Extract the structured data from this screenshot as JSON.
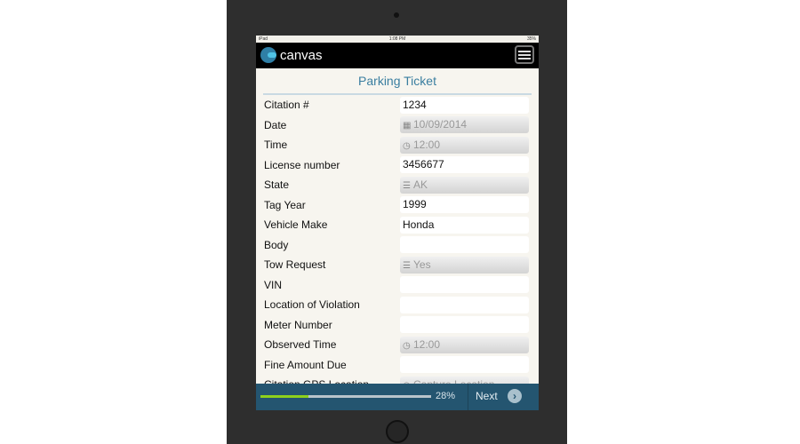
{
  "status": {
    "carrier": "iPad",
    "time": "1:08 PM",
    "battery": "35%"
  },
  "header": {
    "app_name": "canvas",
    "menu_icon": "hamburger-icon"
  },
  "form": {
    "title": "Parking Ticket",
    "fields": [
      {
        "label": "Citation #",
        "value": "1234",
        "type": "text"
      },
      {
        "label": "Date",
        "value": "10/09/2014",
        "type": "date"
      },
      {
        "label": "Time",
        "value": "12:00",
        "type": "time"
      },
      {
        "label": "License number",
        "value": "3456677",
        "type": "text"
      },
      {
        "label": "State",
        "value": "AK",
        "type": "select"
      },
      {
        "label": "Tag Year",
        "value": "1999",
        "type": "text"
      },
      {
        "label": "Vehicle Make",
        "value": "Honda",
        "type": "text"
      },
      {
        "label": "Body",
        "value": "",
        "type": "text"
      },
      {
        "label": "Tow Request",
        "value": "Yes",
        "type": "select"
      },
      {
        "label": "VIN",
        "value": "",
        "type": "text"
      },
      {
        "label": "Location of Violation",
        "value": "",
        "type": "text"
      },
      {
        "label": "Meter Number",
        "value": "",
        "type": "text"
      },
      {
        "label": "Observed Time",
        "value": "12:00",
        "type": "time"
      },
      {
        "label": "Fine Amount Due",
        "value": "",
        "type": "text"
      },
      {
        "label": "Citation GPS Location",
        "value": "Capture Location",
        "type": "gps"
      }
    ]
  },
  "footer": {
    "progress_percent": 28,
    "progress_label": "28%",
    "next_label": "Next",
    "accent": "#8ed11c",
    "bar_color": "#245570"
  }
}
